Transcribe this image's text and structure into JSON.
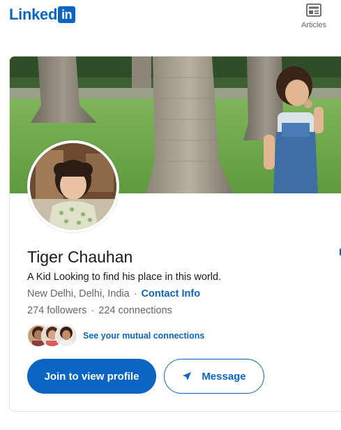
{
  "header": {
    "logo_text": "Linked",
    "logo_box_text": "in",
    "nav_articles_label": "Articles"
  },
  "profile": {
    "name": "Tiger Chauhan",
    "headline": "A Kid Looking to find his place in this world.",
    "location": "New Delhi, Delhi, India",
    "separator": "·",
    "contact_info_label": "Contact Info",
    "followers": "274 followers",
    "connections": "224 connections",
    "mutual_connections_label": "See your mutual connections"
  },
  "actions": {
    "join_label": "Join to view profile",
    "message_label": "Message"
  },
  "colors": {
    "brand_blue": "#0a66c2",
    "text_primary": "#191919",
    "text_secondary": "#666666",
    "grass": "#6fa84a"
  },
  "icons": {
    "articles": "newspaper-icon",
    "message": "send-arrow-icon"
  }
}
